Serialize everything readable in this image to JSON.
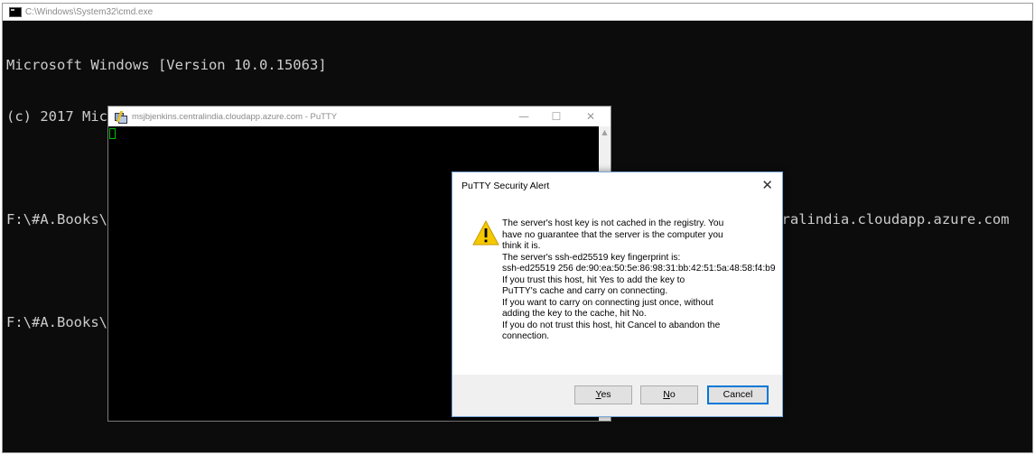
{
  "cmd": {
    "title": "C:\\Windows\\System32\\cmd.exe",
    "lines": [
      "Microsoft Windows [Version 10.0.15063]",
      "(c) 2017 Microsoft Corporation. All rights reserved.",
      "",
      "F:\\#A.Books\\#JenkinsCookBook>putty.exe -ssh -L 8080:localhost:8080 mitesh51@msjbjenkins.centralindia.cloudapp.azure.com",
      "",
      "F:\\#A.Books\\"
    ]
  },
  "putty": {
    "title": "msjbjenkins.centralindia.cloudapp.azure.com - PuTTY",
    "controls": {
      "minimize": "—",
      "maximize": "☐",
      "close": "✕"
    }
  },
  "alert": {
    "title": "PuTTY Security Alert",
    "close": "✕",
    "icon": "warning-icon",
    "message": [
      "The server's host key is not cached in the registry. You",
      "have no guarantee that the server is the computer you",
      "think it is.",
      "The server's ssh-ed25519 key fingerprint is:",
      "ssh-ed25519 256 de:90:ea:50:5e:86:98:31:bb:42:51:5a:48:58:f4:b9",
      "If you trust this host, hit Yes to add the key to",
      "PuTTY's cache and carry on connecting.",
      "If you want to carry on connecting just once, without",
      "adding the key to the cache, hit No.",
      "If you do not trust this host, hit Cancel to abandon the",
      "connection."
    ],
    "buttons": {
      "yes_mnemonic": "Y",
      "yes_rest": "es",
      "no_mnemonic": "N",
      "no_rest": "o",
      "cancel": "Cancel"
    }
  },
  "colors": {
    "cmd_background": "#0c0c0c",
    "cmd_text": "#cccccc",
    "putty_cursor": "#00c000",
    "default_button_border": "#0078d7",
    "warning_yellow": "#f5c800"
  }
}
